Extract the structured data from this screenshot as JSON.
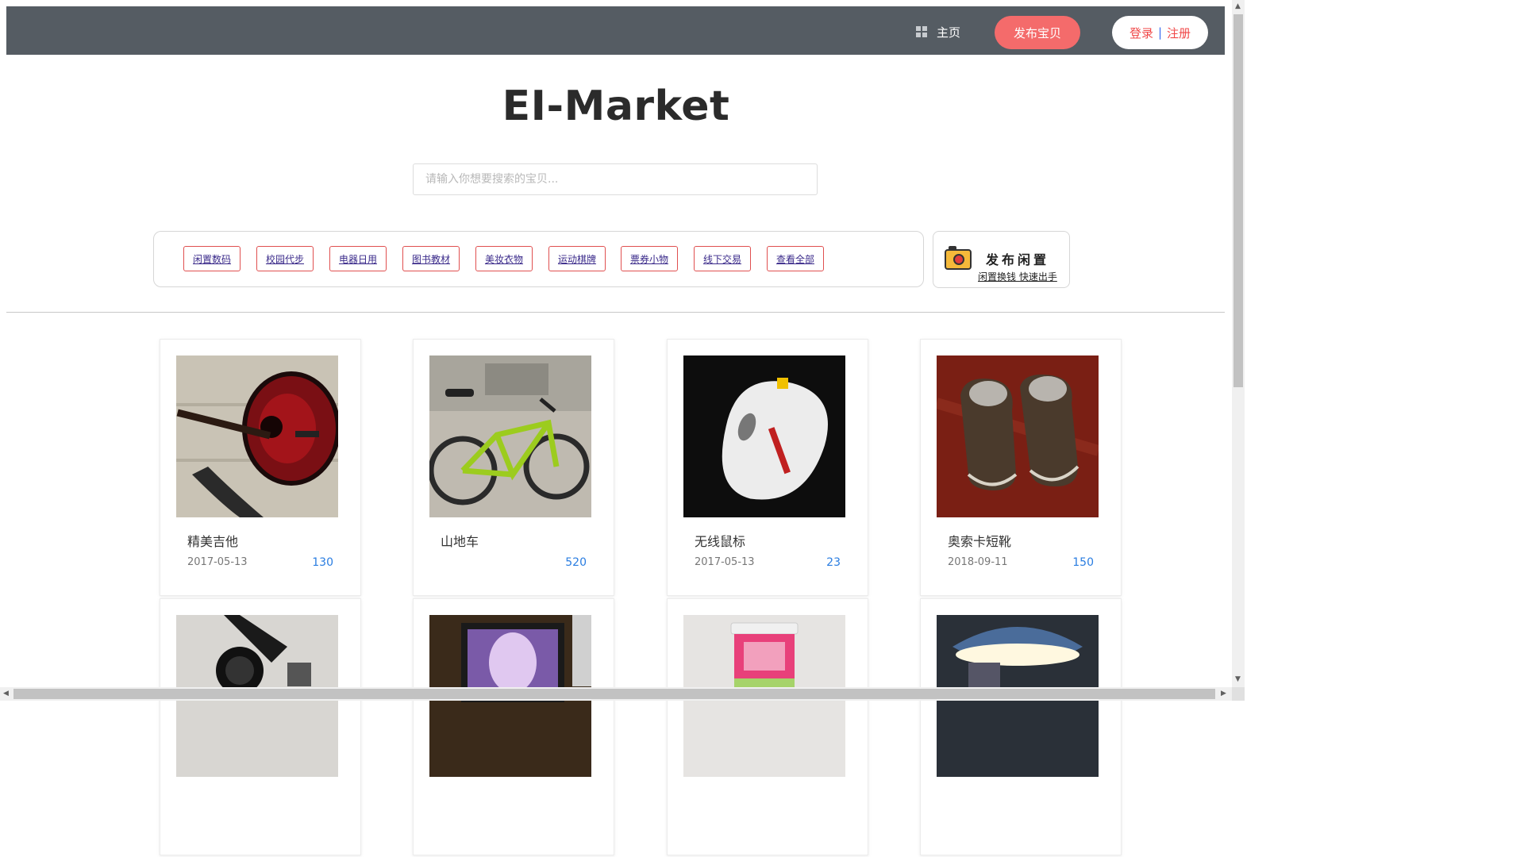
{
  "header": {
    "home_label": "主页",
    "publish_label": "发布宝贝",
    "login_label": "登录",
    "separator": "|",
    "register_label": "注册"
  },
  "logo": "EI-Market",
  "search": {
    "placeholder": "请输入你想要搜索的宝贝...",
    "value": ""
  },
  "categories": [
    "闲置数码",
    "校园代步",
    "电器日用",
    "图书教材",
    "美妆衣物",
    "运动棋牌",
    "票券小物",
    "线下交易",
    "查看全部"
  ],
  "sell_promo": {
    "title": "发布闲置",
    "subtitle": "闲置换钱 快速出手",
    "icon": "camera-icon"
  },
  "products": [
    {
      "title": "精美吉他",
      "date": "2017-05-13",
      "price": "130",
      "image": "guitar"
    },
    {
      "title": "山地车",
      "date": "",
      "price": "520",
      "image": "bicycle"
    },
    {
      "title": "无线鼠标",
      "date": "2017-05-13",
      "price": "23",
      "image": "mouse"
    },
    {
      "title": "奥索卡短靴",
      "date": "2018-09-11",
      "price": "150",
      "image": "boots"
    },
    {
      "title": "",
      "date": "",
      "price": "",
      "image": "camera-lens"
    },
    {
      "title": "",
      "date": "",
      "price": "",
      "image": "laptop"
    },
    {
      "title": "",
      "date": "",
      "price": "",
      "image": "storage-box"
    },
    {
      "title": "",
      "date": "",
      "price": "",
      "image": "desk-lamp"
    }
  ],
  "colors": {
    "header_bg": "#555c63",
    "accent": "#f46b6b",
    "price": "#2a7de1"
  }
}
